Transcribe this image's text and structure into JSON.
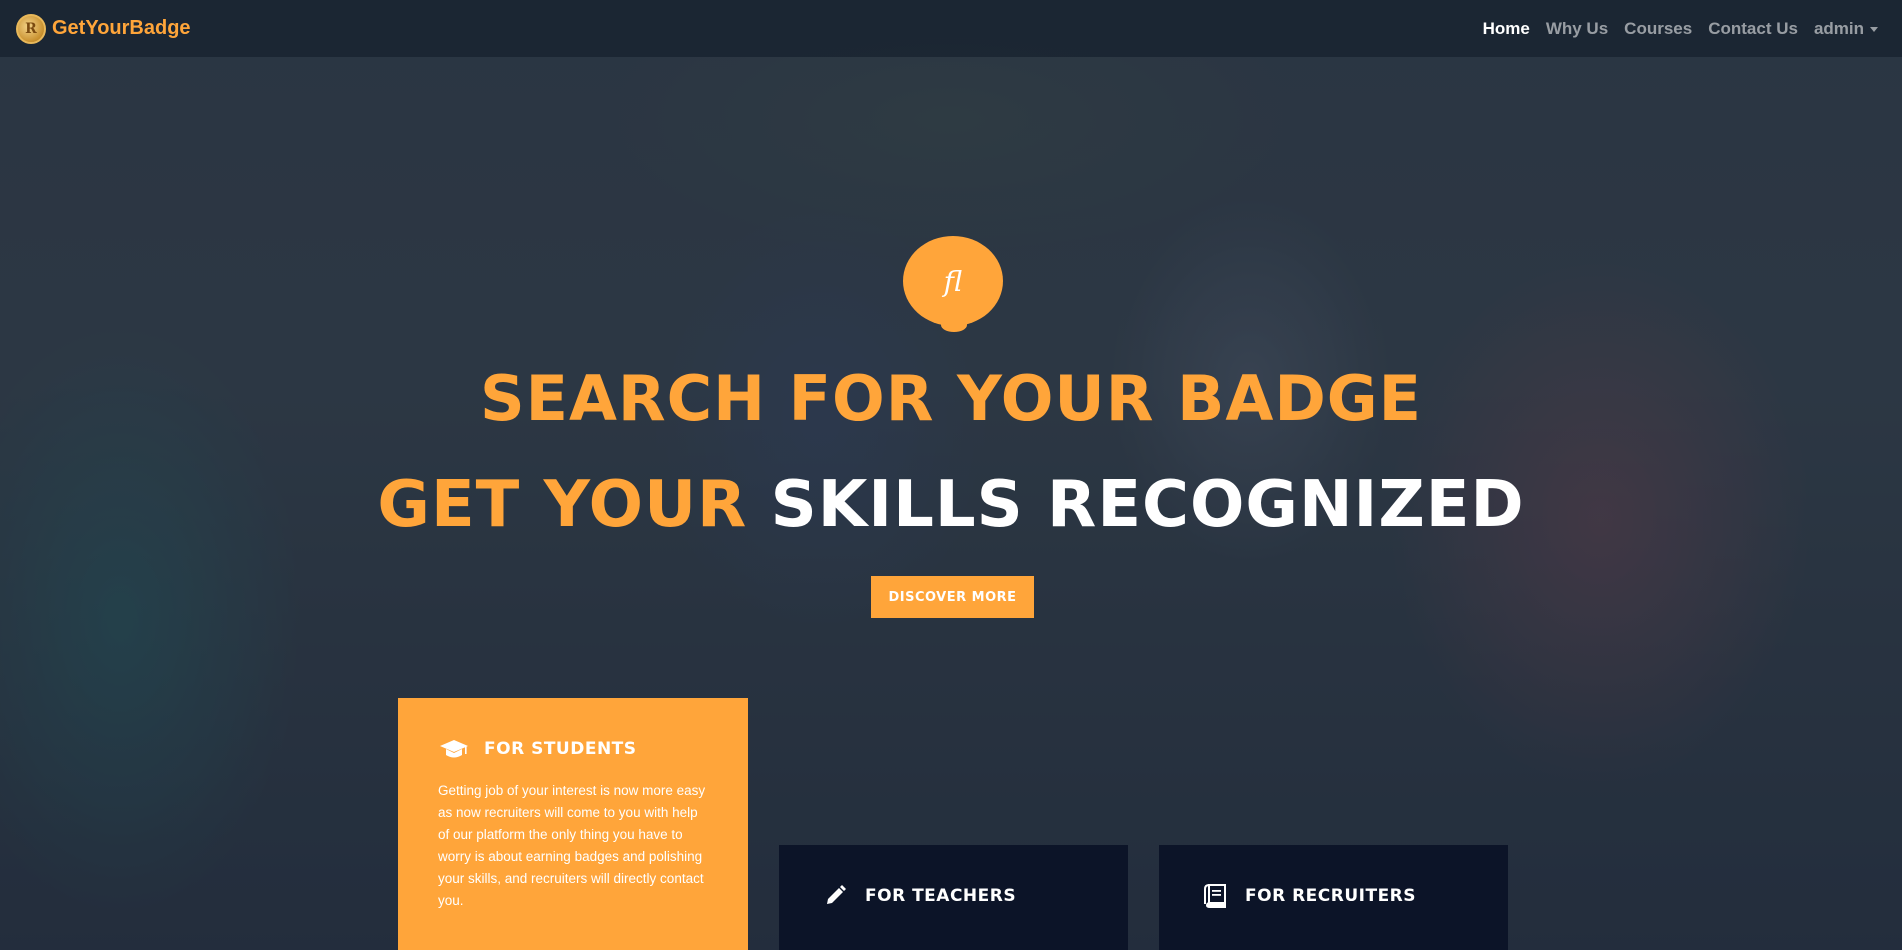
{
  "brand": {
    "name": "GetYourBadge",
    "logo_glyph": "R"
  },
  "nav": {
    "items": [
      {
        "label": "Home",
        "active": true
      },
      {
        "label": "Why Us",
        "active": false
      },
      {
        "label": "Courses",
        "active": false
      },
      {
        "label": "Contact Us",
        "active": false
      }
    ],
    "user_menu_label": "admin"
  },
  "hero": {
    "badge_glyph": "fl",
    "headline_1": "SEARCH FOR YOUR BADGE",
    "headline_2_orange": "GET YOUR",
    "headline_2_white": "SKILLS RECOGNIZED",
    "cta_label": "DISCOVER MORE"
  },
  "cards": {
    "students": {
      "title": "FOR STUDENTS",
      "icon": "graduation-cap-icon",
      "text": "Getting job of your interest is now more easy as now recruiters will come to you with help of our platform the only thing you have to worry is about earning badges and polishing your skills, and recruiters will directly contact you."
    },
    "teachers": {
      "title": "FOR TEACHERS",
      "icon": "pencil-icon"
    },
    "recruiters": {
      "title": "FOR RECRUITERS",
      "icon": "book-icon"
    }
  },
  "colors": {
    "accent": "#ffa53a",
    "dark_card": "#0c1428",
    "nav_active": "#ffffff",
    "nav_inactive": "rgba(255,255,255,0.55)"
  }
}
